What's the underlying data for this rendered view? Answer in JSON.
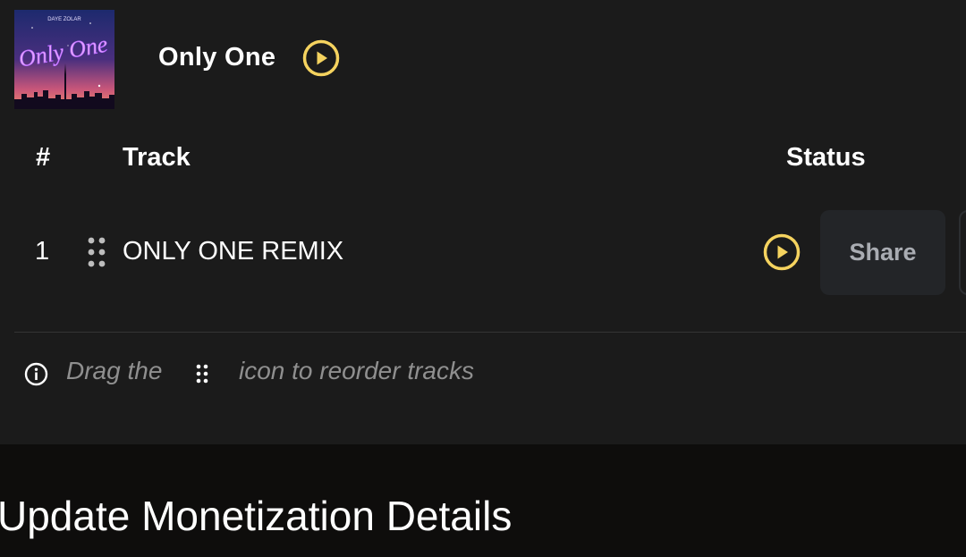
{
  "album": {
    "title": "Only One",
    "cover": {
      "script_text": "Only One",
      "top_text": "DAYE ZOLAR"
    }
  },
  "table": {
    "headers": {
      "number": "#",
      "track": "Track",
      "status": "Status"
    },
    "rows": [
      {
        "number": "1",
        "name": "ONLY ONE REMIX",
        "share_label": "Share"
      }
    ]
  },
  "hint": {
    "before": "Drag the",
    "after": "icon to reorder tracks"
  },
  "section": {
    "title": "Update Monetization Details"
  },
  "colors": {
    "accent": "#f5d35f",
    "panel": "#1b1b1b",
    "page": "#0e0d0c",
    "share_bg": "#232528",
    "hint": "#8f8f8f"
  },
  "icons": {
    "play": "play-circle-icon",
    "drag": "drag-handle-icon",
    "info": "info-icon"
  }
}
